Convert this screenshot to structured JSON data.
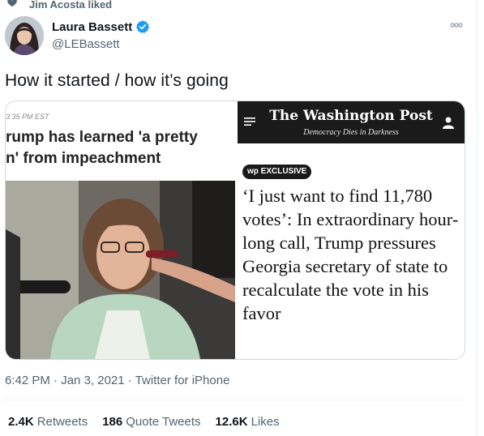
{
  "social_context": {
    "text": "Jim Acosta liked"
  },
  "author": {
    "name": "Laura Bassett",
    "handle": "@LEBassett"
  },
  "tweet": {
    "text": "How it started / how it’s going"
  },
  "media": {
    "left": {
      "timestamp": "3:35 PM EST",
      "headline_line1": "rump has learned 'a pretty",
      "headline_line2": "n' from impeachment"
    },
    "right": {
      "masthead": "The Washington Post",
      "tagline": "Democracy Dies in Darkness",
      "badge": "wp EXCLUSIVE",
      "headline": "‘I just want to find 11,780 votes’: In extraordinary hour-long call, Trump pressures Georgia secretary of state to recalculate the vote in his favor"
    }
  },
  "meta": {
    "time": "6:42 PM",
    "date": "Jan 3, 2021",
    "source": "Twitter for iPhone",
    "separator": " · "
  },
  "stats": {
    "retweets": {
      "count": "2.4K",
      "label": "Retweets"
    },
    "quotes": {
      "count": "186",
      "label": "Quote Tweets"
    },
    "likes": {
      "count": "12.6K",
      "label": "Likes"
    }
  },
  "colors": {
    "accent": "#1d9bf0",
    "text": "#0f1419",
    "muted": "#536471"
  },
  "icons": {
    "liked": "heart-icon",
    "verified": "verified-badge-icon",
    "more": "more-icon",
    "menu": "hamburger-icon",
    "user": "user-icon"
  }
}
